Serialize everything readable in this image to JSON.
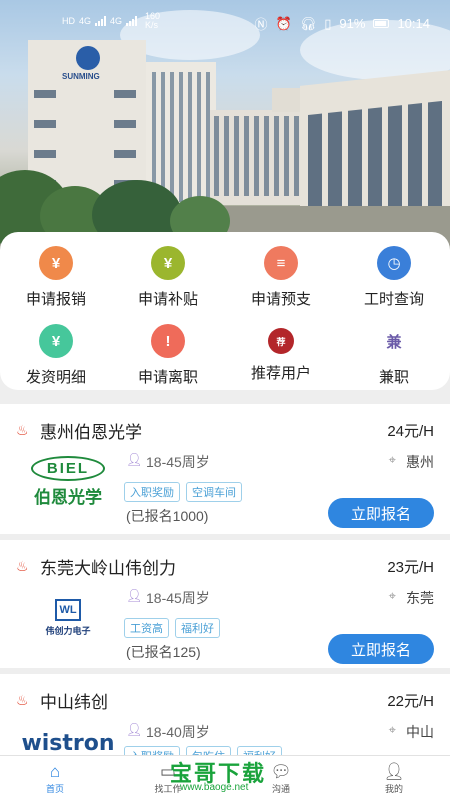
{
  "status": {
    "net_left": "HD",
    "net_4g_a": "4G",
    "net_4g_b": "4G",
    "speed": "160",
    "speed_unit": "K/s",
    "battery": "91%",
    "time": "10:14"
  },
  "hero": {
    "sign": "SUNMING"
  },
  "menu": [
    {
      "label": "申请报销",
      "icon": "money-bag-icon",
      "color": "#f0894a",
      "glyph": "¥"
    },
    {
      "label": "申请补贴",
      "icon": "money-bag-icon",
      "color": "#9bb62e",
      "glyph": "¥"
    },
    {
      "label": "申请预支",
      "icon": "document-icon",
      "color": "#ef7a5f",
      "glyph": "≡"
    },
    {
      "label": "工时查询",
      "icon": "clock-icon",
      "color": "#3a7fd9",
      "glyph": "◷"
    },
    {
      "label": "发资明细",
      "icon": "salary-icon",
      "color": "#46c79b",
      "glyph": "¥"
    },
    {
      "label": "申请离职",
      "icon": "exclamation-icon",
      "color": "#ef6b5a",
      "glyph": "!"
    },
    {
      "label": "推荐用户",
      "icon": "recommend-icon",
      "color": "#b3262a",
      "glyph": "荐"
    },
    {
      "label": "兼职",
      "icon": "part-time-icon",
      "color": "#ffffff",
      "glyph": "兼"
    }
  ],
  "jobs": [
    {
      "title": "惠州伯恩光学",
      "salary": "24元/H",
      "age": "18-45周岁",
      "location": "惠州",
      "tags": [
        "入职奖励",
        "空调车间"
      ],
      "count": "(已报名1000)",
      "apply": "立即报名",
      "logo": {
        "top": "BIEL",
        "bottom": "伯恩光学"
      }
    },
    {
      "title": "东莞大岭山伟创力",
      "salary": "23元/H",
      "age": "18-45周岁",
      "location": "东莞",
      "tags": [
        "工资高",
        "福利好"
      ],
      "count": "(已报名125)",
      "apply": "立即报名",
      "logo": {
        "top": "WL",
        "bottom": "伟创力电子"
      }
    },
    {
      "title": "中山纬创",
      "salary": "22元/H",
      "age": "18-40周岁",
      "location": "中山",
      "tags": [
        "入职奖励",
        "包吃住",
        "福利好"
      ],
      "count": "",
      "apply": "",
      "logo": {
        "top": "wistron",
        "bottom": ""
      }
    }
  ],
  "tabs": [
    {
      "label": "首页",
      "icon": "home-icon",
      "active": true
    },
    {
      "label": "找工作",
      "icon": "briefcase-icon",
      "active": false
    },
    {
      "label": "沟通",
      "icon": "chat-icon",
      "active": false
    },
    {
      "label": "我的",
      "icon": "user-icon",
      "active": false
    }
  ],
  "watermark": {
    "main": "宝哥下载",
    "sub": "www.baoge.net"
  }
}
